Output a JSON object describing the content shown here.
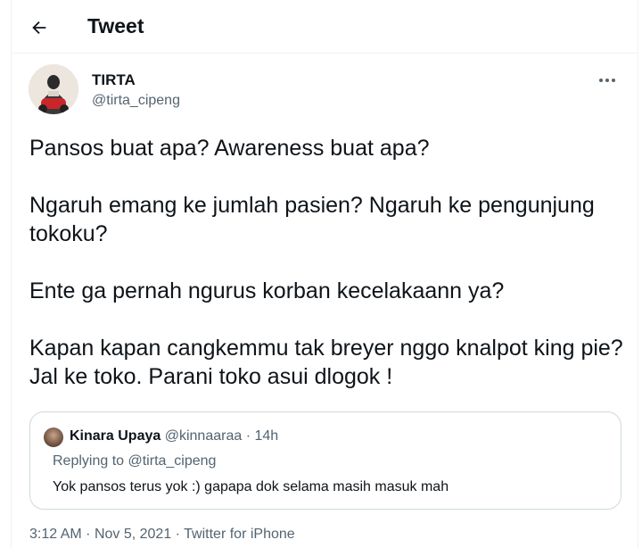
{
  "header": {
    "title": "Tweet",
    "back_icon": "arrow-left-icon"
  },
  "tweet": {
    "author_name": "TIRTA",
    "author_handle": "@tirta_cipeng",
    "more_icon": "more-horizontal-icon",
    "paragraphs": [
      "Pansos buat apa? Awareness buat apa?",
      "Ngaruh emang ke jumlah pasien? Ngaruh ke pengunjung tokoku?",
      "Ente ga pernah ngurus korban kecelakaann ya?",
      "Kapan kapan cangkemmu tak breyer nggo knalpot king pie? Jal ke toko. Parani toko asui dlogok !"
    ]
  },
  "quote": {
    "author_name": "Kinara Upaya",
    "author_handle": "@kinnaaraa",
    "separator": "·",
    "time": "14h",
    "replying_to": "Replying to @tirta_cipeng",
    "text": "Yok pansos terus yok :) gapapa dok selama masih masuk mah"
  },
  "meta": {
    "time": "3:12 AM",
    "separator1": "·",
    "date": "Nov 5, 2021",
    "separator2": "·",
    "source": "Twitter for iPhone"
  },
  "colors": {
    "text": "#0f1419",
    "secondary": "#536471",
    "border": "#cfd9de",
    "divider": "#eff3f4"
  }
}
